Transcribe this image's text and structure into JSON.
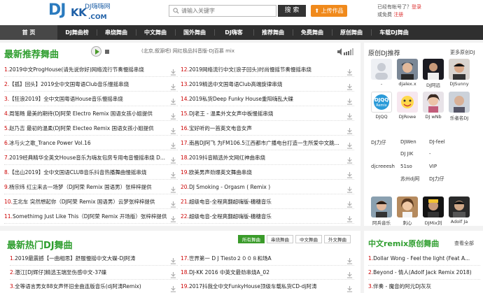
{
  "header": {
    "logo_dj": "DJ",
    "logo_kk": "KK",
    "logo_cn": "DJ嗨嗨网",
    "logo_com": ".COM",
    "search_placeholder": "请输入关键字",
    "search_button": "搜 索",
    "upload_button": "上传作品",
    "has_account": "已经有帐号了？",
    "login": "登录",
    "free_account": "或免费",
    "register": "注册"
  },
  "nav": [
    "首 页",
    "DJ舞曲榜",
    "串烧舞曲",
    "中文舞曲",
    "国外舞曲",
    "DJ嗨客",
    "推荐舞曲",
    "免费舞曲",
    "原创舞曲",
    "车载DJ舞曲"
  ],
  "main": {
    "title": "最新推荐舞曲",
    "now_playing": "(北京,叙源吧)  网红极品抖音版-DJ百慕 mix",
    "left_songs": [
      {
        "num": "1.",
        "title": "2019中文ProgHouse(请先说你好)网络流行节奏慢摇串烧"
      },
      {
        "num": "2.",
        "title": "【孤】回头】2019全中文国粤语Club音乐慢摇串烧"
      },
      {
        "num": "3.",
        "title": "【狂浪2019】全中文国粤语House音乐慢摇串烧"
      },
      {
        "num": "4.",
        "title": "周笔畅 最美的期待(DJ阿荣 Electro Remix 国语女孩小姐提供"
      },
      {
        "num": "5.",
        "title": "赵乃吉 最初的温柔(DJ阿荣 Electeo Remix 国语女孩小姐提供"
      },
      {
        "num": "6.",
        "title": "冰与火之歌_Trance Power Vol.16"
      },
      {
        "num": "7.",
        "title": "2019经典精华全英文House音乐为嗨友包房专用电音慢摇串烧 D..."
      },
      {
        "num": "8.",
        "title": "【出山2019】全中文国语CLUB音乐抖音热播舞曲慢摇串烧"
      },
      {
        "num": "9.",
        "title": "杨宗纬 红尘来去一场梦（DJ阿荣 Remix 国语男）张梓梓提供"
      },
      {
        "num": "10.",
        "title": "王北车 突然想起你（DJ阿荣 Remix 国语男）云梦张梓梓提供"
      },
      {
        "num": "11.",
        "title": "Somethimg Just Like This（DJ阿荣 Remix 开场版）张梓梓提供"
      }
    ],
    "right_songs": [
      {
        "num": "12.",
        "title": "2019网络流行中文(浪子回头)时尚慢摇节奏慢摇串烧"
      },
      {
        "num": "13.",
        "title": "2019精选中文国粤语Club高端旋律串烧"
      },
      {
        "num": "14.",
        "title": "2019私货Deep Funky House重阳嗨乱大碟"
      },
      {
        "num": "15.",
        "title": "DJ老王 - 温柔外文女声中板慢摇串烧"
      },
      {
        "num": "16.",
        "title": "宝好听的一首英文电音女声"
      },
      {
        "num": "17.",
        "title": "南昌DJ阿飞 为FM106.5江西都市广播电台打造一生所爱中文跳..."
      },
      {
        "num": "18.",
        "title": "2019抖音精选外文网红神曲串烧"
      },
      {
        "num": "19.",
        "title": "欧美男声劲爆英文舞曲串烧"
      },
      {
        "num": "20.",
        "title": "DJ Smoking - Orgasm ( Remix )"
      },
      {
        "num": "21.",
        "title": "超级电音-全程爽翻超嗨版-穗穗音乐"
      },
      {
        "num": "22.",
        "title": "超级电音-全程爽翻超嗨版-穗穗音乐"
      }
    ]
  },
  "sidebar": {
    "title": "原创DJ推荐",
    "more": "更多原创DJ",
    "row1": [
      "-",
      "djalex.x",
      "DJ阿远",
      "DJSunny"
    ],
    "row2": [
      "DJQQ",
      "DJRowe",
      "DJ wNb",
      "乐者名DJ"
    ],
    "list": [
      [
        "DJ力仔",
        "DJWen",
        "DJ-feel"
      ],
      [
        "",
        "DJ JIK",
        "-"
      ],
      [
        "djcreeesh",
        "51so",
        "VIP"
      ],
      [
        "",
        "苏州dj阿",
        "DJ力仔"
      ]
    ],
    "row3": [
      "阿兵音乐",
      "刺心",
      "DJMix刘",
      "Adolf Ja"
    ],
    "djqq_badge": "DJQQ\nRemix"
  },
  "hot": {
    "title": "最新热门DJ舞曲",
    "tabs": [
      "所有舞曲",
      "串烧舞曲",
      "中文舞曲",
      "外文舞曲"
    ],
    "left_songs": [
      {
        "num": "1.",
        "title": "2019最震撼【一曲相思】舒服慢摇中文大碟-DJ阿涛"
      },
      {
        "num": "2.",
        "title": "潜江[DJ辉仔]精选玉瑞至伤感中文-37碟"
      },
      {
        "num": "3.",
        "title": "全等语言男女88女声怀旧金曲连版音乐(dj阿涛Remix)"
      }
    ],
    "right_songs": [
      {
        "num": "17.",
        "title": "世界第一 D J Tiesto２００８和场A"
      },
      {
        "num": "18.",
        "title": "DJ-KK 2016 中英文最劲串烧A_02"
      },
      {
        "num": "19.",
        "title": "2017抖我全中文FunkyHouse顶级车载私货CD-dj阿涛"
      }
    ]
  },
  "remix": {
    "title": "中文remix原创舞曲",
    "more": "查看全部",
    "songs": [
      {
        "num": "1.",
        "title": "Dollar Wong - Feel the light  (Feat A..."
      },
      {
        "num": "2.",
        "title": "Beyond - 情人(Adolf Jack Remix 2018)"
      },
      {
        "num": "3.",
        "title": "伴奏 - 魔音的阿元DJ灰灰"
      }
    ]
  },
  "colors": {
    "accent_green": "#2f9e2f",
    "nav_bg": "#2f2f2f",
    "upload_orange": "#f08a1c",
    "link_red": "#d33"
  }
}
